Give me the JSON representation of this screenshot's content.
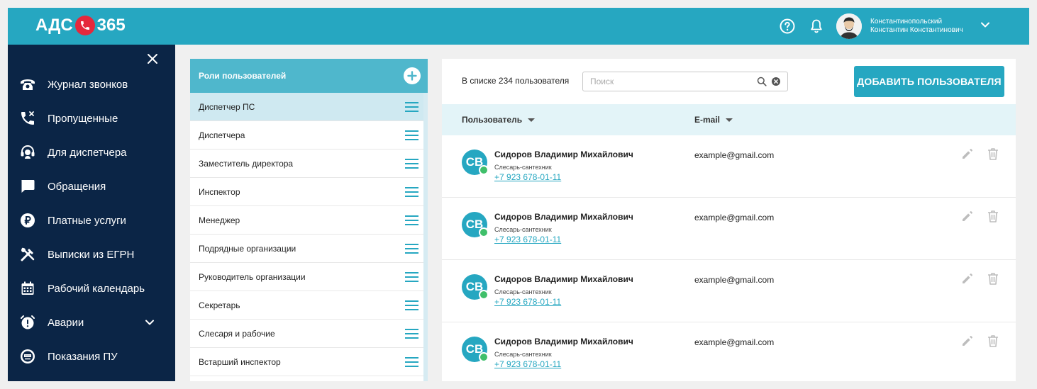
{
  "header": {
    "logo_left": "АДС",
    "logo_right": "365",
    "user_line1": "Константинопольский",
    "user_line2": "Константин Константинович"
  },
  "sidebar": {
    "items": [
      {
        "label": "Журнал звонков",
        "icon": "phone-icon"
      },
      {
        "label": "Пропущенные",
        "icon": "missed-call-icon"
      },
      {
        "label": "Для диспетчера",
        "icon": "headset-icon"
      },
      {
        "label": "Обращения",
        "icon": "chat-icon"
      },
      {
        "label": "Платные услуги",
        "icon": "ruble-icon"
      },
      {
        "label": "Выписки из ЕГРН",
        "icon": "tools-icon"
      },
      {
        "label": "Рабочий календарь",
        "icon": "calendar-icon"
      },
      {
        "label": "Аварии",
        "icon": "alarm-icon"
      },
      {
        "label": "Показания ПУ",
        "icon": "meter-icon"
      }
    ]
  },
  "roles": {
    "title": "Роли пользователей",
    "items": [
      "Диспетчер ПС",
      "Диспетчера",
      "Заместитель директора",
      "Инспектор",
      "Менеджер",
      "Подрядные организации",
      "Руководитель организации",
      "Секретарь",
      "Слесаря и рабочие",
      "Встарший инспектор"
    ]
  },
  "users": {
    "count_text": "В списке 234 пользователя",
    "search_placeholder": "Поиск",
    "add_button": "ДОБАВИТЬ ПОЛЬЗОВАТЕЛЯ",
    "col_user": "Пользователь",
    "col_email": "E-mail",
    "rows": [
      {
        "initials": "СВ",
        "name": "Сидоров Владимир Михайлович",
        "position": "Слесарь-сантехник",
        "phone": "+7 923 678-01-11",
        "email": "example@gmail.com"
      },
      {
        "initials": "СВ",
        "name": "Сидоров Владимир Михайлович",
        "position": "Слесарь-сантехник",
        "phone": "+7 923 678-01-11",
        "email": "example@gmail.com"
      },
      {
        "initials": "СВ",
        "name": "Сидоров Владимир Михайлович",
        "position": "Слесарь-сантехник",
        "phone": "+7 923 678-01-11",
        "email": "example@gmail.com"
      },
      {
        "initials": "СВ",
        "name": "Сидоров Владимир Михайлович",
        "position": "Слесарь-сантехник",
        "phone": "+7 923 678-01-11",
        "email": "example@gmail.com"
      }
    ]
  },
  "colors": {
    "accent": "#26a7c1",
    "sidebar": "#0b2546",
    "logo_badge": "#e5283c",
    "online": "#3fbf6a"
  }
}
